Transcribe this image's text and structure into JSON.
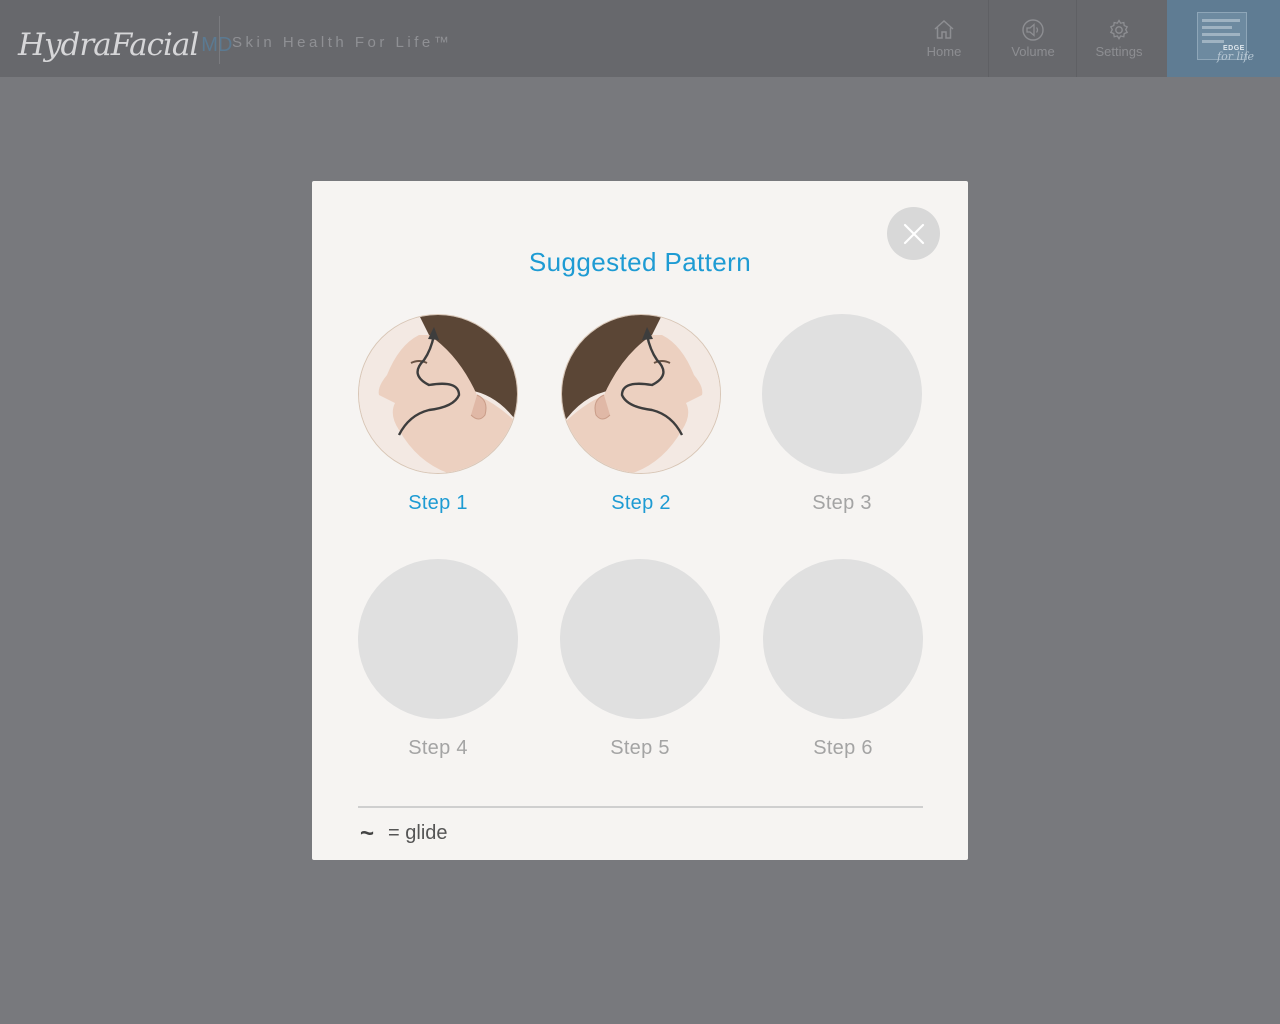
{
  "header": {
    "brand_script": "HydraFacial",
    "brand_suffix": "MD",
    "tagline": "Skin Health For Life™",
    "nav": [
      {
        "label": "Home",
        "icon": "home-icon"
      },
      {
        "label": "Volume",
        "icon": "volume-icon"
      },
      {
        "label": "Settings",
        "icon": "gear-icon"
      }
    ],
    "edge_logo_word": "EDGE",
    "edge_logo_tagline": "for life"
  },
  "modal": {
    "title": "Suggested Pattern",
    "close_icon": "close-icon",
    "accent_color": "#1e9bd3",
    "steps": [
      {
        "label": "Step 1",
        "active": true,
        "image": "face-profile-left-glide-pattern"
      },
      {
        "label": "Step 2",
        "active": true,
        "image": "face-profile-right-glide-pattern"
      },
      {
        "label": "Step 3",
        "active": false
      },
      {
        "label": "Step 4",
        "active": false
      },
      {
        "label": "Step 5",
        "active": false
      },
      {
        "label": "Step 6",
        "active": false
      }
    ],
    "legend": {
      "glyph": "~",
      "text": "= glide"
    }
  }
}
